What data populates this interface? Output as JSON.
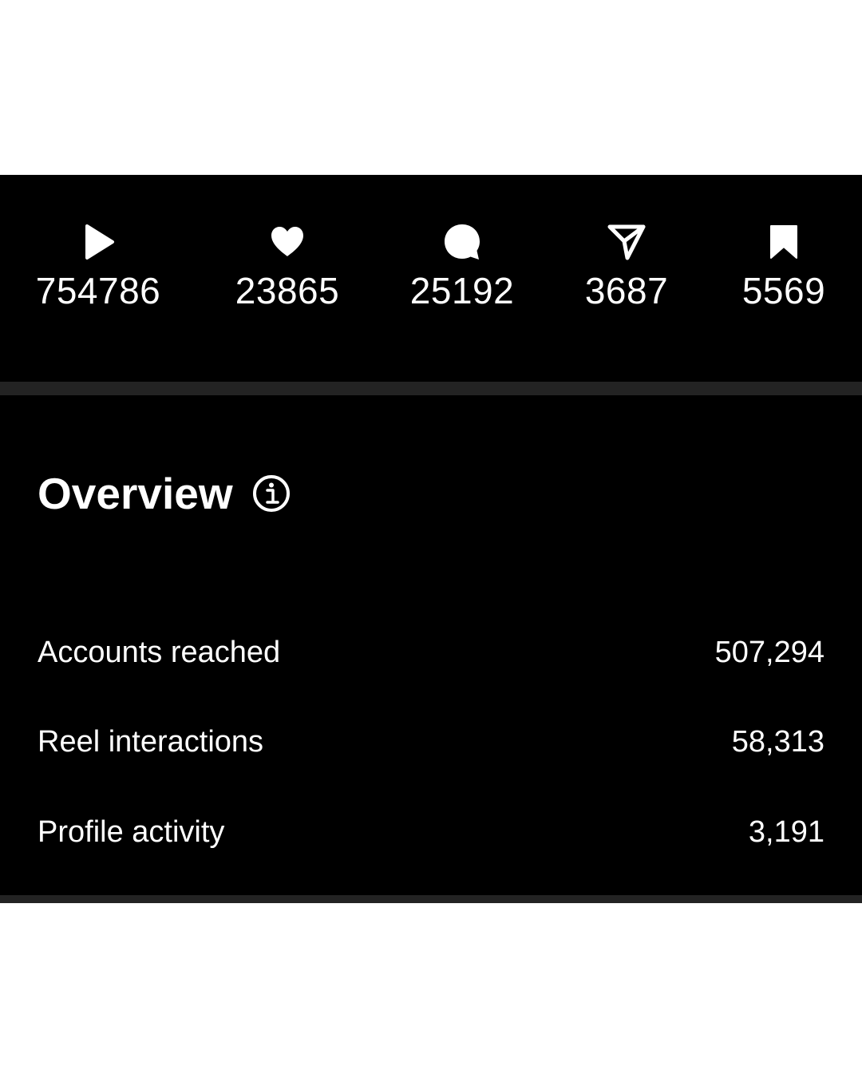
{
  "stats": [
    {
      "icon": "play-icon",
      "value": "754786"
    },
    {
      "icon": "heart-icon",
      "value": "23865"
    },
    {
      "icon": "comment-icon",
      "value": "25192"
    },
    {
      "icon": "share-icon",
      "value": "3687"
    },
    {
      "icon": "bookmark-icon",
      "value": "5569"
    }
  ],
  "overview": {
    "title": "Overview",
    "info_icon": "info-icon",
    "metrics": [
      {
        "label": "Accounts reached",
        "value": "507,294"
      },
      {
        "label": "Reel interactions",
        "value": "58,313"
      },
      {
        "label": "Profile activity",
        "value": "3,191"
      }
    ]
  },
  "colors": {
    "panel_background": "#000000",
    "divider": "#232323",
    "text": "#ffffff",
    "page_background": "#ffffff"
  }
}
